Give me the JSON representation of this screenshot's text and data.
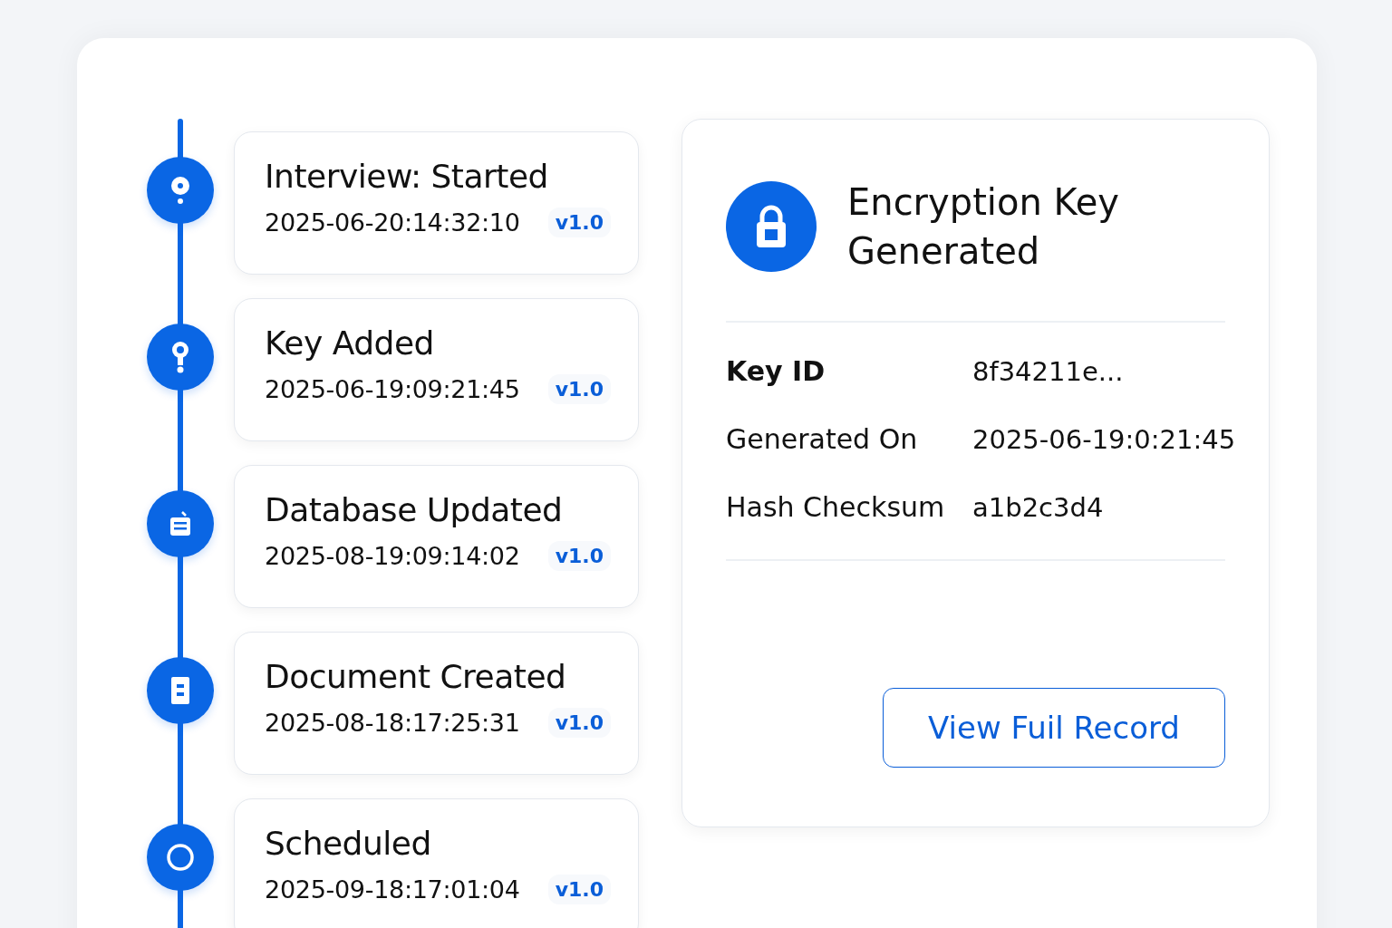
{
  "timeline": [
    {
      "kind": "dot",
      "title": "Interview: Started",
      "timestamp": "2025-06-20:14:32:10",
      "version": "v1.0"
    },
    {
      "kind": "key",
      "title": "Key Added",
      "timestamp": "2025-06-19:09:21:45",
      "version": "v1.0"
    },
    {
      "kind": "database",
      "title": "Database Updated",
      "timestamp": "2025-08-19:09:14:02",
      "version": "v1.0"
    },
    {
      "kind": "document",
      "title": "Document Created",
      "timestamp": "2025-08-18:17:25:31",
      "version": "v1.0"
    },
    {
      "kind": "circle",
      "title": "Scheduled",
      "timestamp": "2025-09-18:17:01:04",
      "version": "v1.0"
    }
  ],
  "detail": {
    "title": "Encryption Key Generated",
    "fields": [
      {
        "label": "Key ID",
        "value": "8f34211e...",
        "strong": true
      },
      {
        "label": "Generated On",
        "value": "2025-06-19:0:21:45",
        "strong": false
      },
      {
        "label": "Hash Checksum",
        "value": "a1b2c3d4",
        "strong": false
      }
    ],
    "button": "View Fuil Record"
  }
}
